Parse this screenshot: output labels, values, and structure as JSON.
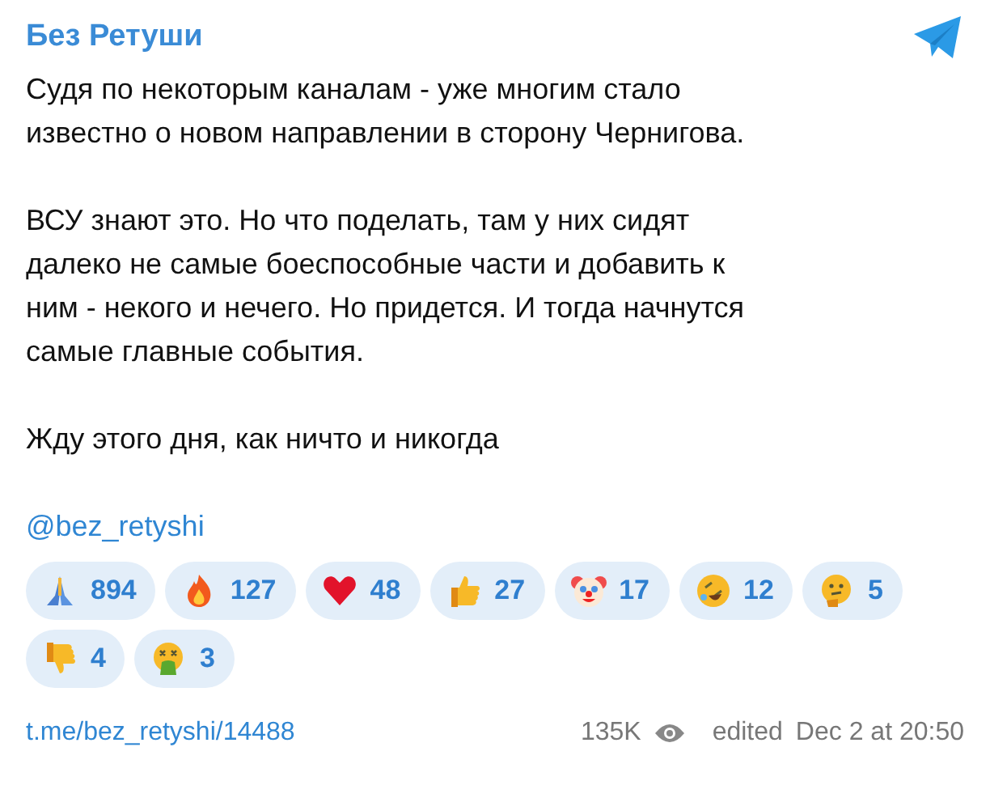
{
  "channel": {
    "name": "Без Ретуши"
  },
  "paragraphs": [
    {
      "lines": [
        "Судя по некоторым каналам - уже многим стало",
        "известно о новом направлении в сторону Чернигова."
      ]
    },
    {
      "lines": [
        "ВСУ знают это. Но что поделать, там у них сидят",
        "далеко не самые боеспособные части и добавить к",
        "ним - некого и нечего. Но придется. И тогда начнутся",
        "самые главные события."
      ]
    },
    {
      "lines": [
        "Жду этого дня, как ничто и никогда"
      ]
    }
  ],
  "mention": "@bez_retyshi",
  "reactions": [
    {
      "kind": "pray",
      "count": "894"
    },
    {
      "kind": "fire",
      "count": "127"
    },
    {
      "kind": "heart",
      "count": "48"
    },
    {
      "kind": "thumbsup",
      "count": "27"
    },
    {
      "kind": "clown",
      "count": "17"
    },
    {
      "kind": "rofl",
      "count": "12"
    },
    {
      "kind": "thinking",
      "count": "5"
    },
    {
      "kind": "thumbsdown",
      "count": "4"
    },
    {
      "kind": "vomit",
      "count": "3"
    }
  ],
  "footer": {
    "link": "t.me/bez_retyshi/14488",
    "views": "135K",
    "edited": "edited",
    "date": "Dec 2 at 20:50"
  }
}
